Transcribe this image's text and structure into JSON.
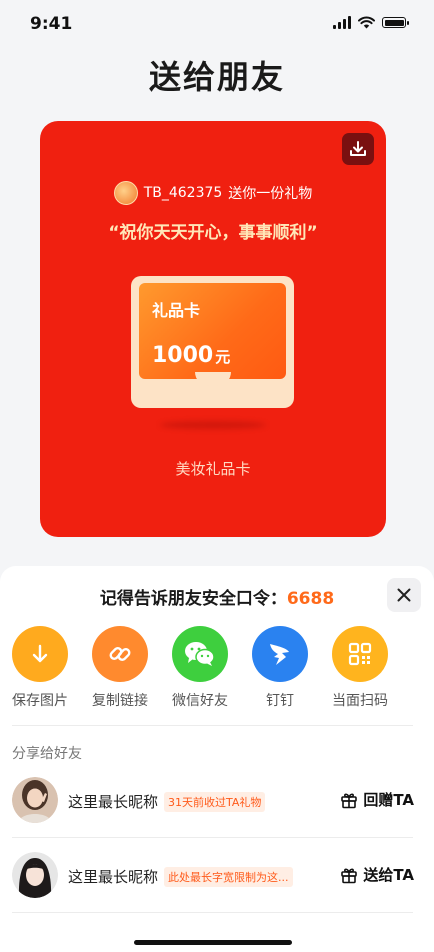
{
  "status": {
    "time": "9:41"
  },
  "page": {
    "title": "送给朋友"
  },
  "card": {
    "sender": "TB_462375",
    "sender_action": "送你一份礼物",
    "wish": "“祝你天天开心，事事顺利”",
    "gift_label": "礼品卡",
    "gift_amount": "1000",
    "gift_unit": "元",
    "card_name": "美妆礼品卡",
    "bg_color": "#f02010"
  },
  "sheet": {
    "password_label": "记得告诉朋友安全口令：",
    "password_code": "6688",
    "share_options": [
      {
        "label": "保存图片",
        "icon": "download-icon",
        "color": "#ffaa1e"
      },
      {
        "label": "复制链接",
        "icon": "link-icon",
        "color": "#ff8a2e"
      },
      {
        "label": "微信好友",
        "icon": "wechat-icon",
        "color": "#3ecf3e"
      },
      {
        "label": "钉钉",
        "icon": "dingtalk-icon",
        "color": "#2a82f0"
      },
      {
        "label": "当面扫码",
        "icon": "qrcode-icon",
        "color": "#ffb41e"
      }
    ],
    "section_title": "分享给好友",
    "friends": [
      {
        "name": "这里最长昵称",
        "tag": "31天前收过TA礼物",
        "action": "回赠TA"
      },
      {
        "name": "这里最长昵称",
        "tag": "此处最长字宽限制为这...",
        "action": "送给TA"
      }
    ]
  }
}
